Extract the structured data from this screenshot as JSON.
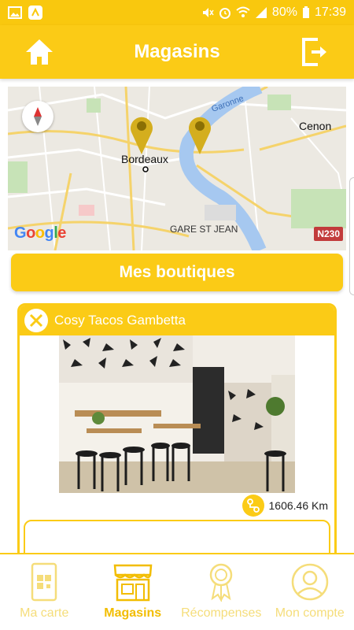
{
  "status_bar": {
    "battery": "80%",
    "time": "17:39"
  },
  "header": {
    "title": "Magasins"
  },
  "map": {
    "labels": {
      "bordeaux": "Bordeaux",
      "cenon": "Cenon",
      "garonne": "Garonne",
      "gare": "GARE ST JEAN",
      "route": "N230"
    },
    "provider": "Google"
  },
  "mes_boutiques_label": "Mes boutiques",
  "shop": {
    "name": "Cosy Tacos Gambetta",
    "distance": "1606.46 Km"
  },
  "nav": {
    "items": [
      {
        "label": "Ma carte",
        "icon": "qr-card-icon"
      },
      {
        "label": "Magasins",
        "icon": "store-icon"
      },
      {
        "label": "Récompenses",
        "icon": "award-icon"
      },
      {
        "label": "Mon compte",
        "icon": "account-icon"
      }
    ]
  },
  "colors": {
    "accent": "#fbcb16",
    "nav_inactive": "#f5dd7a",
    "nav_active": "#f2bd00"
  }
}
